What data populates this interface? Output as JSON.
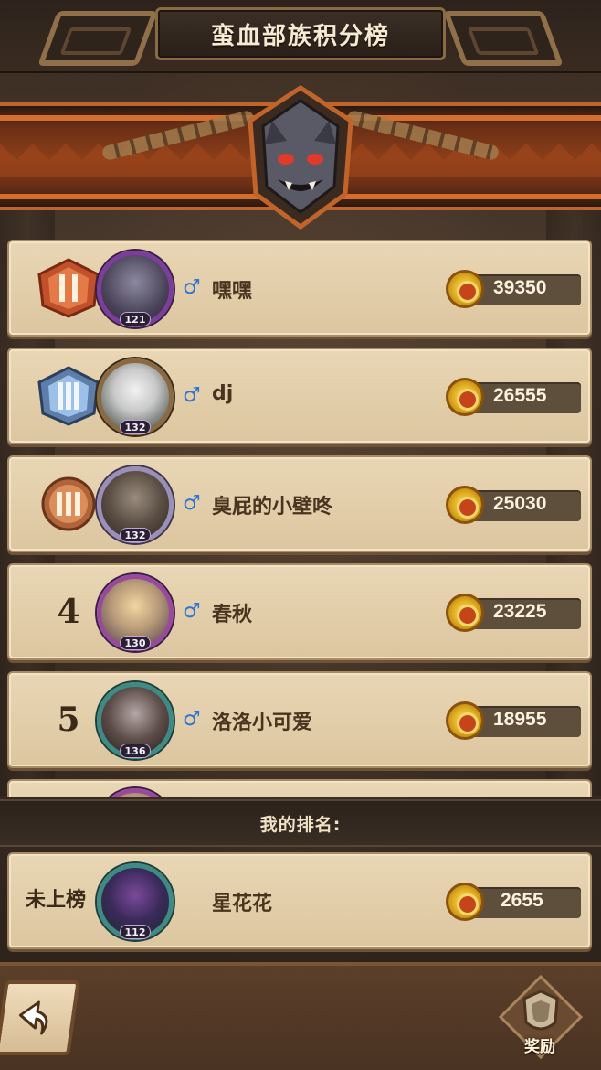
{
  "header": {
    "title": "蛮血部族积分榜"
  },
  "leaderboard": [
    {
      "rank": "1",
      "rank_badge": "gold-rank-badge",
      "name": "嘿嘿",
      "level": "121",
      "gender": "♂",
      "score": "39350",
      "avatar_frame": "purple"
    },
    {
      "rank": "2",
      "rank_badge": "silver-rank-badge",
      "name": "dj",
      "level": "132",
      "gender": "♂",
      "score": "26555",
      "avatar_frame": "bronze"
    },
    {
      "rank": "3",
      "rank_badge": "bronze-rank-badge",
      "name": "臭屁的小壁咚",
      "level": "132",
      "gender": "♂",
      "score": "25030",
      "avatar_frame": "silver"
    },
    {
      "rank": "4",
      "rank_badge": "",
      "name": "春秋",
      "level": "130",
      "gender": "♂",
      "score": "23225",
      "avatar_frame": "pink"
    },
    {
      "rank": "5",
      "rank_badge": "",
      "name": "洛洛小可爱",
      "level": "136",
      "gender": "♂",
      "score": "18955",
      "avatar_frame": "teal"
    }
  ],
  "my_rank": {
    "title": "我的排名:",
    "status": "未上榜",
    "name": "星花花",
    "level": "112",
    "score": "2655"
  },
  "footer": {
    "reward_label": "奖励",
    "back_icon": "back-arrow-icon",
    "reward_icon": "reward-shield-icon"
  },
  "colors": {
    "row_bg": "#e9d6b4",
    "score_bg": "#5e4e3c",
    "banner_orange": "#c0642c",
    "gender_blue": "#2f74d6"
  }
}
